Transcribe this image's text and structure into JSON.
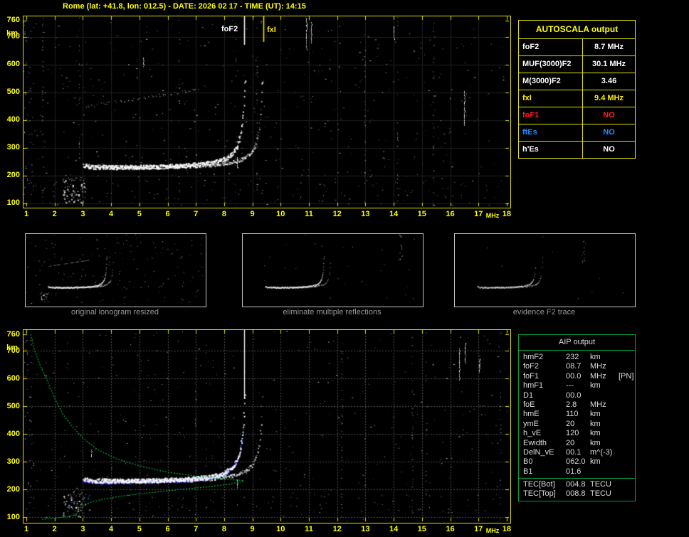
{
  "title": "Rome (lat: +41.8, lon: 012.5) - DATE: 2026 02 17 - TIME (UT): 14:15",
  "axes": {
    "y_unit": "km",
    "x_unit": "MHz",
    "y_ticks": [
      "760",
      "700",
      "600",
      "500",
      "400",
      "300",
      "200",
      "100"
    ],
    "x_ticks": [
      "1",
      "2",
      "3",
      "4",
      "5",
      "6",
      "7",
      "8",
      "9",
      "10",
      "11",
      "12",
      "13",
      "14",
      "15",
      "16",
      "17",
      "18"
    ]
  },
  "top_plot": {
    "markers": [
      {
        "label": "foF2",
        "freq": 8.7,
        "color": "#ffffff"
      },
      {
        "label": "fxI",
        "freq": 9.4,
        "color": "#ffee00"
      }
    ]
  },
  "autoscala_table": {
    "header": "AUTOSCALA output",
    "rows": [
      {
        "label": "foF2",
        "value": "8.7 MHz",
        "color": "#ffffff"
      },
      {
        "label": "MUF(3000)F2",
        "value": "30.1 MHz",
        "color": "#ffffff"
      },
      {
        "label": "M(3000)F2",
        "value": "3.46",
        "color": "#ffffff"
      },
      {
        "label": "fxI",
        "value": "9.4 MHz",
        "color": "#ffee00"
      },
      {
        "label": "foF1",
        "value": "NO",
        "color": "#ff2020"
      },
      {
        "label": "ftEs",
        "value": "NO",
        "color": "#1e8fff"
      },
      {
        "label": "h'Es",
        "value": "NO",
        "color": "#ffffff"
      }
    ]
  },
  "thumbnails": [
    {
      "caption": "original ionogram resized"
    },
    {
      "caption": "eliminate multiple reflections"
    },
    {
      "caption": "evidence F2 trace"
    }
  ],
  "aip_table": {
    "header": "AIP output",
    "rows": [
      {
        "label": "hmF2",
        "value": "232",
        "unit": "km",
        "extra": ""
      },
      {
        "label": "foF2",
        "value": "08.7",
        "unit": "MHz",
        "extra": ""
      },
      {
        "label": "foF1",
        "value": "00.0",
        "unit": "MHz",
        "extra": "[PN]"
      },
      {
        "label": "hmF1",
        "value": "---",
        "unit": "km",
        "extra": ""
      },
      {
        "label": "D1",
        "value": "00.0",
        "unit": "",
        "extra": ""
      },
      {
        "label": "foE",
        "value": "2.8",
        "unit": "MHz",
        "extra": ""
      },
      {
        "label": "hmE",
        "value": "110",
        "unit": "km",
        "extra": ""
      },
      {
        "label": "ymE",
        "value": "20",
        "unit": "km",
        "extra": ""
      },
      {
        "label": "h_vE",
        "value": "120",
        "unit": "km",
        "extra": ""
      },
      {
        "label": "Ewidth",
        "value": "20",
        "unit": "km",
        "extra": ""
      },
      {
        "label": "DelN_vE",
        "value": "00.1",
        "unit": "m^(-3)",
        "extra": ""
      },
      {
        "label": "B0",
        "value": "062.0",
        "unit": "km",
        "extra": ""
      },
      {
        "label": "B1",
        "value": "01.6",
        "unit": "",
        "extra": ""
      }
    ],
    "tec_rows": [
      {
        "label": "TEC[Bot]",
        "value": "004.8",
        "unit": "TECU",
        "extra": ""
      },
      {
        "label": "TEC[Top]",
        "value": "008.8",
        "unit": "TECU",
        "extra": ""
      }
    ]
  },
  "chart_data": {
    "type": "scatter",
    "description": "Vertical-incidence ionogram: virtual height (km) vs sounding frequency (MHz). White dots = echo traces (O and X mode F2 trace plus second hop and noise), blue = autoscaled F2 trace, green = AIP electron density profile.",
    "xlabel": "MHz",
    "ylabel": "km",
    "x_range": [
      1,
      18
    ],
    "y_range": [
      90,
      770
    ],
    "foF2_MHz": 8.7,
    "fxI_MHz": 9.4,
    "MUF3000F2_MHz": 30.1,
    "M3000F2": 3.46,
    "hmF2_km": 232,
    "f2_trace_start_MHz": 3.0,
    "f2_trace_base_height_km": 228,
    "profile_points_f_h": [
      [
        1.15,
        760
      ],
      [
        1.3,
        700
      ],
      [
        1.5,
        645
      ],
      [
        1.75,
        590
      ],
      [
        2.0,
        530
      ],
      [
        2.3,
        470
      ],
      [
        2.6,
        430
      ],
      [
        3.0,
        385
      ],
      [
        3.5,
        345
      ],
      [
        4.2,
        310
      ],
      [
        5.0,
        285
      ],
      [
        6.0,
        262
      ],
      [
        7.0,
        248
      ],
      [
        8.0,
        238
      ],
      [
        8.55,
        233
      ],
      [
        8.7,
        232
      ],
      [
        8.55,
        226
      ],
      [
        8.2,
        219
      ],
      [
        7.5,
        210
      ],
      [
        6.3,
        198
      ],
      [
        5.2,
        186
      ],
      [
        4.3,
        175
      ],
      [
        3.7,
        164
      ],
      [
        3.3,
        154
      ],
      [
        3.05,
        144
      ],
      [
        2.9,
        134
      ],
      [
        2.83,
        124
      ],
      [
        2.8,
        114
      ],
      [
        2.72,
        107
      ],
      [
        2.4,
        101
      ],
      [
        1.9,
        95
      ],
      [
        1.5,
        92
      ]
    ]
  }
}
